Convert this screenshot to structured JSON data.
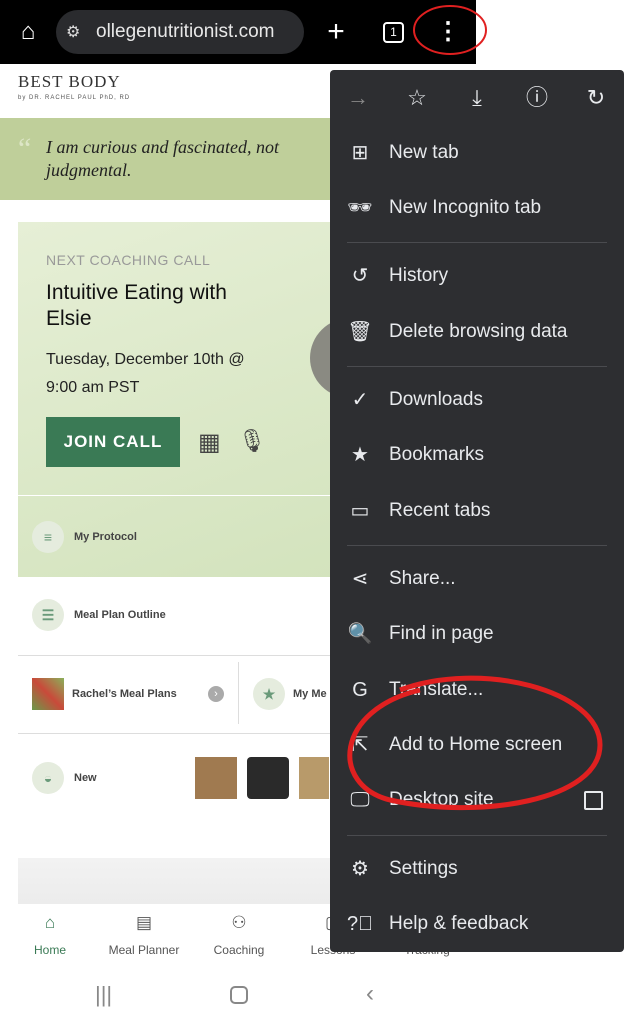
{
  "browser": {
    "url": "ollegenutritionist.com",
    "tab_count": "1"
  },
  "page": {
    "brand": "BEST BODY",
    "brand_sub": "by DR. RACHEL PAUL PhD, RD",
    "quote": "I am curious and fascinated, not judgmental.",
    "coaching": {
      "label": "NEXT COACHING CALL",
      "title": "Intuitive Eating with Elsie",
      "date": "Tuesday, December 10th @ 9:00 am PST",
      "join": "JOIN CALL"
    },
    "rows": {
      "protocol": "My Protocol",
      "meal_plan_outline": "Meal Plan Outline",
      "rachels_meal_plans": "Rachel’s Meal Plans",
      "my_meals": "My Me",
      "new": "New"
    },
    "bottom_nav": [
      "Home",
      "Meal Planner",
      "Coaching",
      "Lessons",
      "Tracking"
    ],
    "accent": "#3a7a55"
  },
  "menu": {
    "items": [
      "New tab",
      "New Incognito tab",
      "History",
      "Delete browsing data",
      "Downloads",
      "Bookmarks",
      "Recent tabs",
      "Share...",
      "Find in page",
      "Translate...",
      "Add to Home screen",
      "Desktop site",
      "Settings",
      "Help & feedback"
    ],
    "background": "#2d2e31"
  },
  "annotation_color": "#e02020"
}
